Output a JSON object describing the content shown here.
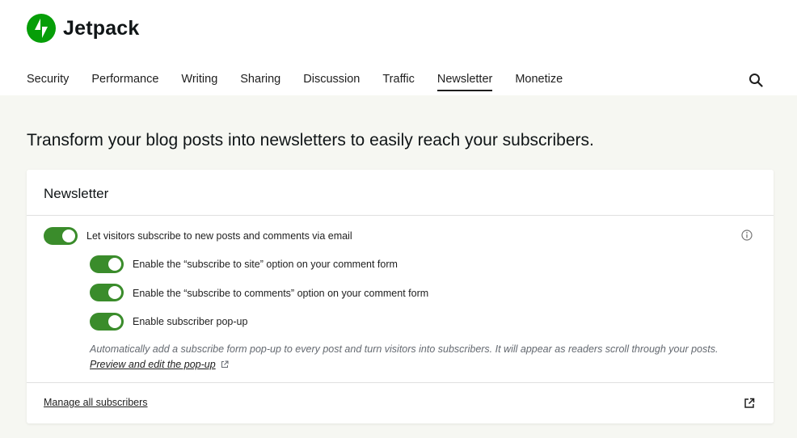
{
  "app": {
    "logo_text": "Jetpack",
    "brand_color": "#069e08"
  },
  "nav": {
    "items": [
      {
        "label": "Security"
      },
      {
        "label": "Performance"
      },
      {
        "label": "Writing"
      },
      {
        "label": "Sharing"
      },
      {
        "label": "Discussion"
      },
      {
        "label": "Traffic"
      },
      {
        "label": "Newsletter",
        "active": true
      },
      {
        "label": "Monetize"
      }
    ],
    "search_icon": "search-icon"
  },
  "main": {
    "headline": "Transform your blog posts into newsletters to easily reach your subscribers."
  },
  "card": {
    "title": "Newsletter",
    "main_toggle": {
      "label": "Let visitors subscribe to new posts and comments via email",
      "on": true
    },
    "sub_toggles": [
      {
        "label": "Enable the “subscribe to site” option on your comment form",
        "on": true
      },
      {
        "label": "Enable the “subscribe to comments” option on your comment form",
        "on": true
      },
      {
        "label": "Enable subscriber pop-up",
        "on": true
      }
    ],
    "help_text": "Automatically add a subscribe form pop-up to every post and turn visitors into subscribers. It will appear as readers scroll through your posts.",
    "help_link": "Preview and edit the pop-up",
    "footer_link": "Manage all subscribers",
    "toggle_color": "#3a8c2b"
  }
}
